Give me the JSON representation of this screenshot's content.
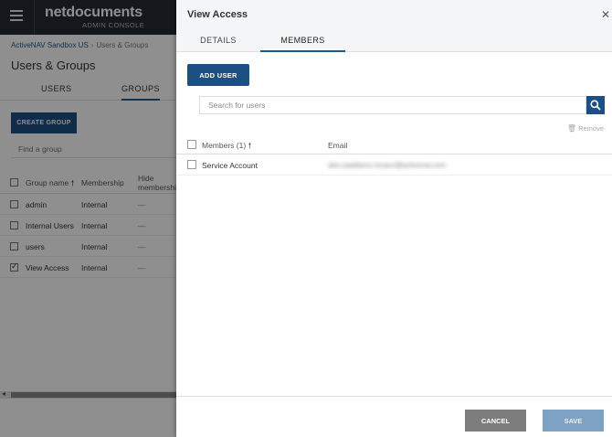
{
  "app": {
    "logo": "netdocuments",
    "logo_sub": "ADMIN CONSOLE",
    "breadcrumb": [
      "ActiveNAV Sandbox US",
      "Users & Groups"
    ],
    "page_title": "Users & Groups",
    "tabs": [
      {
        "label": "USERS"
      },
      {
        "label": "GROUPS"
      }
    ],
    "create_group": "CREATE GROUP",
    "find_placeholder": "Find a group",
    "columns": {
      "name": "Group name",
      "membership": "Membership",
      "hide": "Hide membership"
    },
    "groups": [
      {
        "name": "admin",
        "membership": "Internal",
        "hide": "—"
      },
      {
        "name": "Internal Users",
        "membership": "Internal",
        "hide": "—"
      },
      {
        "name": "users",
        "membership": "Internal",
        "hide": "—"
      },
      {
        "name": "View Access",
        "membership": "Internal",
        "hide": "—",
        "checked": true
      }
    ]
  },
  "drawer": {
    "title": "View Access",
    "tabs": [
      {
        "label": "DETAILS"
      },
      {
        "label": "MEMBERS",
        "active": true
      }
    ],
    "add_user": "ADD USER",
    "search_placeholder": "Search for users",
    "remove": "Remove",
    "columns": {
      "members": "Members (1)",
      "email": "Email"
    },
    "members": [
      {
        "name": "Service Account",
        "email": "alex.waddams-rocacci@activenav.com"
      }
    ],
    "cancel": "CANCEL",
    "save": "SAVE"
  },
  "icons": {
    "menu": "hamburger-icon",
    "close": "close-icon",
    "search": "search-icon",
    "trash": "trash-icon",
    "sort": "sort-up-icon"
  },
  "colors": {
    "primary": "#1d4f82",
    "topbar": "#252a30",
    "cancel": "#7d7d7d",
    "save_disabled": "#7da2c4"
  }
}
